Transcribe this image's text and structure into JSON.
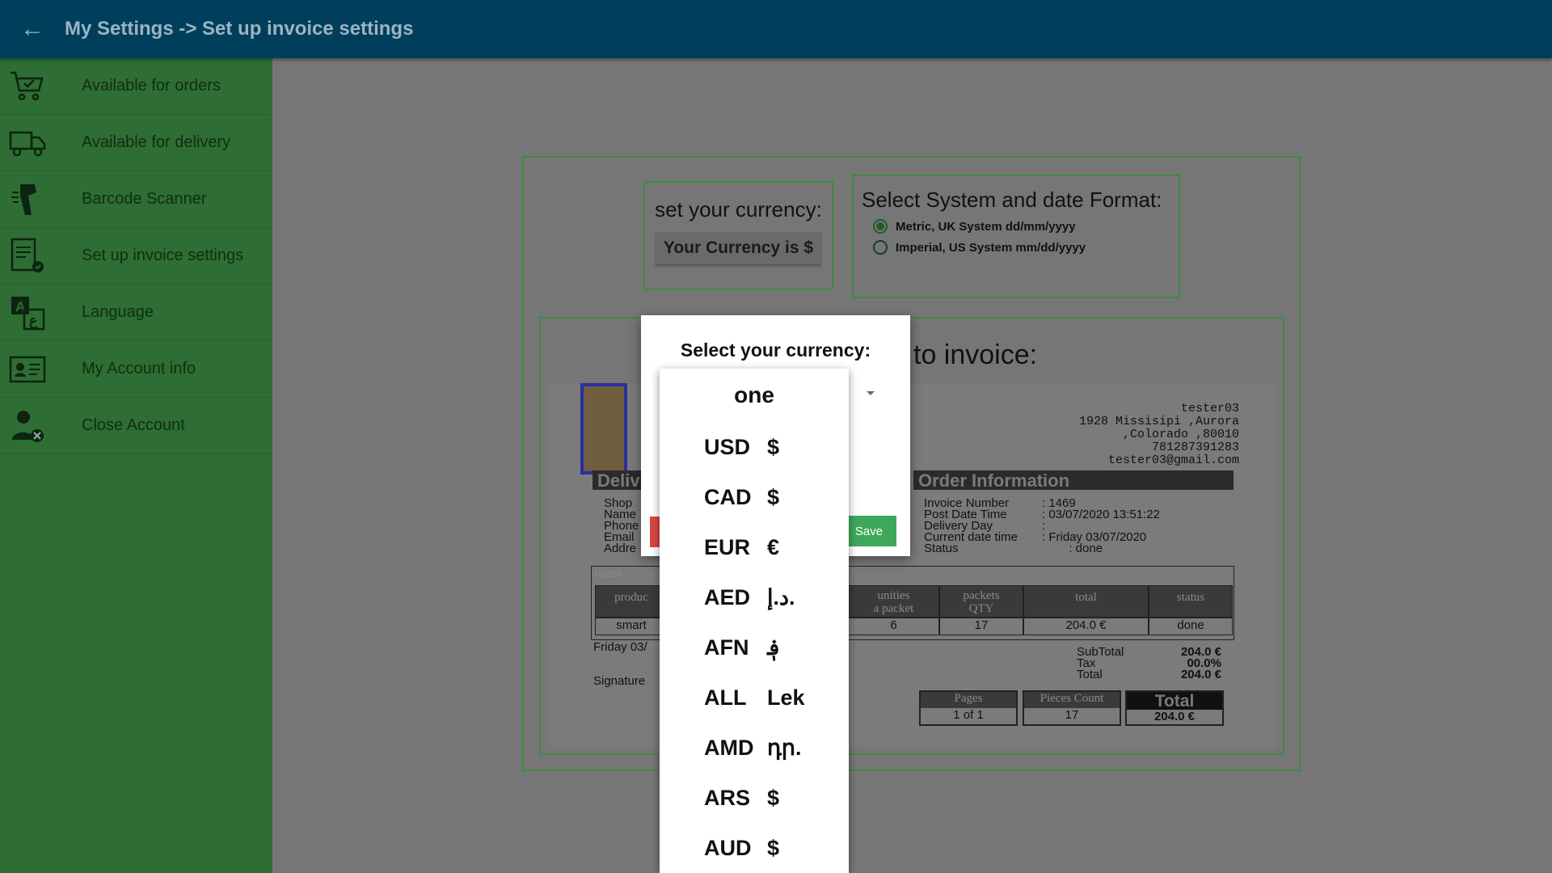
{
  "header": {
    "back_icon": "arrow-left-icon",
    "title": "My Settings -> Set up invoice settings"
  },
  "sidebar": {
    "items": [
      {
        "label": "Available for orders",
        "icon": "cart-check-icon"
      },
      {
        "label": "Available for delivery",
        "icon": "truck-icon"
      },
      {
        "label": "Barcode Scanner",
        "icon": "barcode-scanner-icon"
      },
      {
        "label": "Set up invoice settings",
        "icon": "invoice-settings-icon"
      },
      {
        "label": "Language",
        "icon": "language-icon"
      },
      {
        "label": "My Account info",
        "icon": "account-card-icon"
      },
      {
        "label": "Close Account",
        "icon": "user-remove-icon"
      }
    ]
  },
  "currency_panel": {
    "label": "set your currency:",
    "button": "Your Currency is $"
  },
  "format_panel": {
    "label": "Select System and date Format:",
    "options": [
      {
        "label": "Metric, UK System  dd/mm/yyyy",
        "selected": true
      },
      {
        "label": "Imperial, US System  mm/dd/yyyy",
        "selected": false
      }
    ]
  },
  "invoice_panel": {
    "title_partial": "to invoice:",
    "sender": [
      "tester03",
      "1928 Missisipi ,Aurora",
      ",Colorado ,80010",
      "781287391283",
      "tester03@gmail.com"
    ],
    "delivery_bar": "Deliv",
    "order_bar": "Order Information",
    "left_labels": [
      "Shop",
      "Name",
      "Phone",
      "Email",
      "Addre"
    ],
    "order_info": [
      {
        "k": "Invoice Number",
        "v": ": 1469"
      },
      {
        "k": "Post Date Time",
        "v": ": 03/07/2020 13:51:22"
      },
      {
        "k": "Delivery Day",
        "v": ":"
      },
      {
        "k": "Current date time",
        "v": ": Friday 03/07/2020"
      },
      {
        "k": "Status",
        "v": "        : done"
      }
    ],
    "items_label": "Items",
    "table_headers": [
      "produc",
      "unities\na packet",
      "packets\nQTY",
      "total",
      "status"
    ],
    "table_row": [
      "smart",
      "6",
      "17",
      "204.0 €",
      "done"
    ],
    "date_partial": "Friday 03/",
    "signature": "Signature",
    "totals": [
      {
        "k": "SubTotal",
        "v": "204.0 €"
      },
      {
        "k": "Tax",
        "v": "00.0%"
      },
      {
        "k": "Total",
        "v": "204.0 €"
      }
    ],
    "footer": [
      {
        "k": "Pages",
        "v": "1 of 1"
      },
      {
        "k": "Pieces Count",
        "v": "17"
      },
      {
        "k": "Total",
        "v": "204.0 €"
      }
    ]
  },
  "modal": {
    "title": "Select your currency:",
    "save": "Save"
  },
  "dropdown": {
    "first": "one",
    "items": [
      {
        "code": "USD",
        "symbol": "$"
      },
      {
        "code": "CAD",
        "symbol": "$"
      },
      {
        "code": "EUR",
        "symbol": "€"
      },
      {
        "code": "AED",
        "symbol": "د.إ."
      },
      {
        "code": "AFN",
        "symbol": "؋"
      },
      {
        "code": "ALL",
        "symbol": "Lek"
      },
      {
        "code": "AMD",
        "symbol": "դր."
      },
      {
        "code": "ARS",
        "symbol": "$"
      },
      {
        "code": "AUD",
        "symbol": "$"
      }
    ]
  },
  "colors": {
    "appbar": "#003f5c",
    "sidebar": "#2e6d33",
    "save": "#3ea85a",
    "cancel": "#d94545"
  }
}
